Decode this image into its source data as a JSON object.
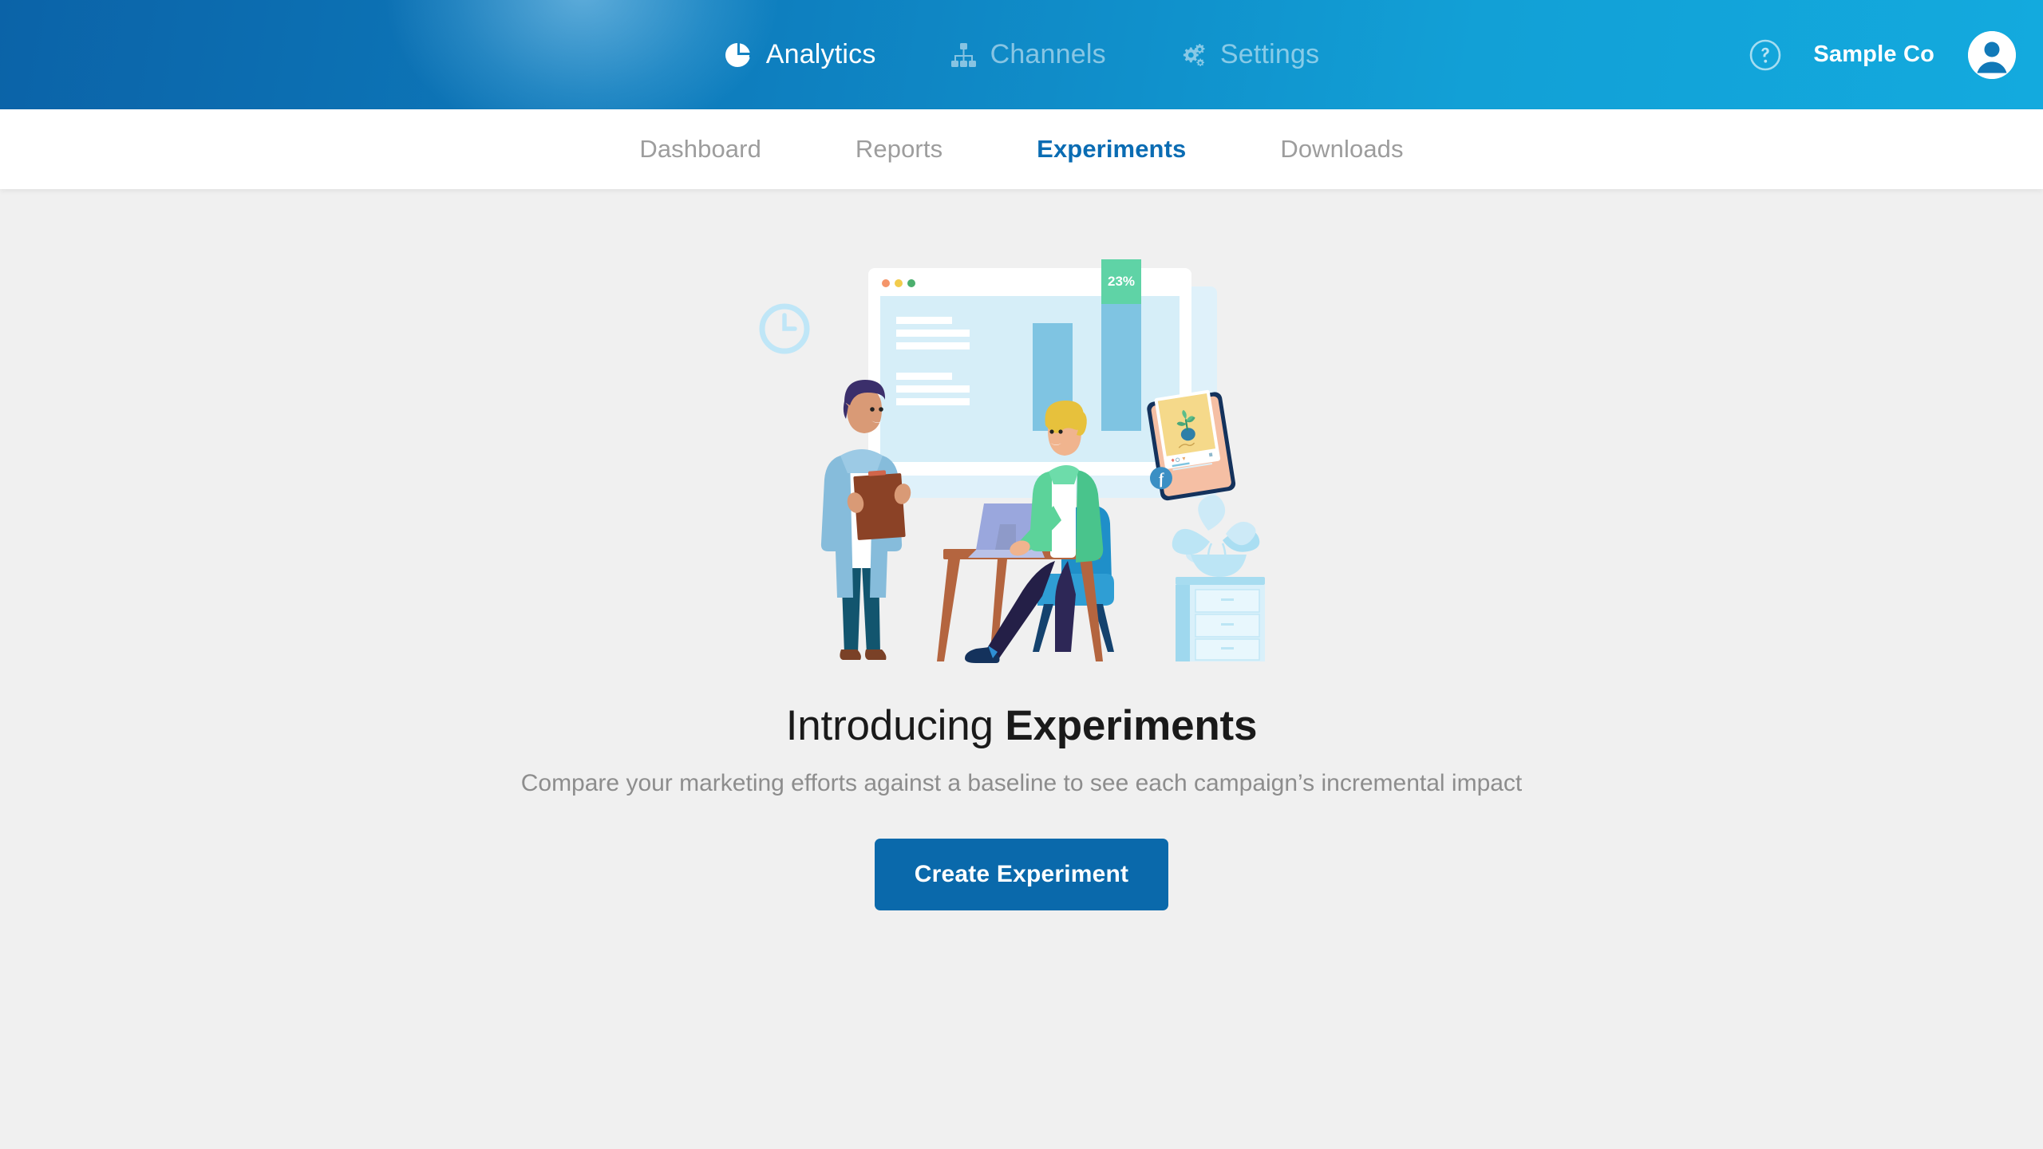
{
  "header": {
    "nav": [
      {
        "label": "Analytics",
        "icon": "pie-chart-icon",
        "active": true
      },
      {
        "label": "Channels",
        "icon": "sitemap-icon",
        "active": false
      },
      {
        "label": "Settings",
        "icon": "gears-icon",
        "active": false
      }
    ],
    "help_icon": "help-circle-icon",
    "company": "Sample Co",
    "avatar_icon": "user-avatar-icon",
    "gradient_from": "#0b63a8",
    "gradient_to": "#13aade"
  },
  "subnav": {
    "tabs": [
      {
        "label": "Dashboard",
        "active": false
      },
      {
        "label": "Reports",
        "active": false
      },
      {
        "label": "Experiments",
        "active": true
      },
      {
        "label": "Downloads",
        "active": false
      }
    ],
    "active_color": "#0a6cb3",
    "inactive_color": "#9d9d9d"
  },
  "main": {
    "headline_light": "Introducing ",
    "headline_bold": "Experiments",
    "subhead": "Compare your marketing efforts against a baseline to see each campaign’s incremental impact",
    "cta_label": "Create Experiment",
    "cta_color": "#0a69ab",
    "background": "#f0f0f0"
  },
  "illustration": {
    "name": "experiments-hero-illustration",
    "clock_icon": "clock-icon",
    "browser": {
      "dots": [
        "#f4956a",
        "#f2cc4c",
        "#4caf6e"
      ],
      "uplift_badge": "23%",
      "uplift_color": "#5fd3a6",
      "bar_color": "#7fc4e2",
      "panel_color": "#d6eef8"
    },
    "phone": {
      "social_badge": "facebook-icon",
      "badge_color": "#3b8fc4",
      "photo_bg": "#f5d98a",
      "body_color": "#f5bfa4",
      "frame_color": "#14325c"
    },
    "people": [
      {
        "name": "standing-person",
        "hair": "#3b2f6b",
        "coat": "#86bcdb",
        "pants": "#12556e"
      },
      {
        "name": "seated-person",
        "hair": "#e7c13c",
        "blazer": "#5cd39a",
        "pants": "#241f47"
      }
    ],
    "furniture": {
      "desk_color": "#b4653f",
      "chair_color": "#1f8fc9",
      "cabinet_color": "#d9f0fa",
      "plant_color": "#bce5f5"
    }
  }
}
